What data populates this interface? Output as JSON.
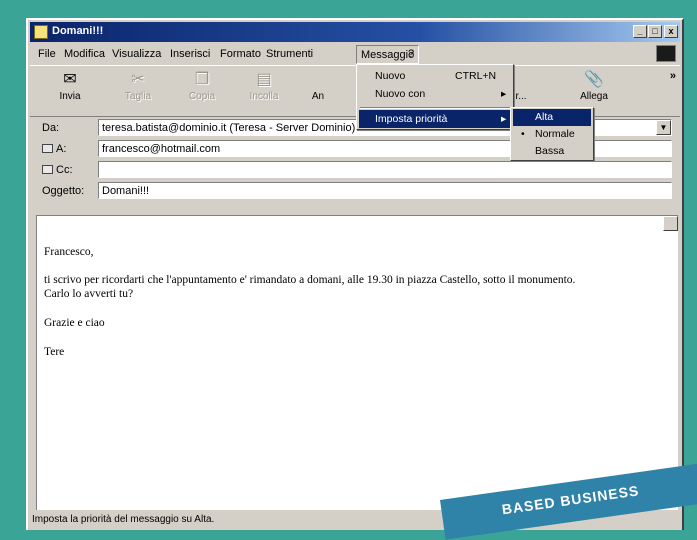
{
  "window": {
    "title": "Domani!!!",
    "controls": {
      "minimize": "_",
      "maximize": "□",
      "close": "x"
    }
  },
  "menubar": {
    "items": [
      "File",
      "Modifica",
      "Visualizza",
      "Inserisci",
      "Formato",
      "Strumenti",
      "Messaggio",
      "?"
    ]
  },
  "toolbar": {
    "buttons": [
      {
        "label": "Invia",
        "icon": "send-icon",
        "enabled": true
      },
      {
        "label": "Taglia",
        "icon": "scissors-icon",
        "enabled": false
      },
      {
        "label": "Copia",
        "icon": "copy-icon",
        "enabled": false
      },
      {
        "label": "Incolla",
        "icon": "paste-icon",
        "enabled": false
      },
      {
        "label": "An",
        "icon": "undo-icon",
        "enabled": true
      },
      {
        "label": "r...",
        "icon": "",
        "enabled": true
      },
      {
        "label": "Allega",
        "icon": "paperclip-icon",
        "enabled": true
      }
    ],
    "overflow": "»"
  },
  "fields": {
    "from": {
      "label": "Da:",
      "value": "teresa.batista@dominio.it   (Teresa - Server Dominio)"
    },
    "to": {
      "label": "A:",
      "value": "francesco@hotmail.com"
    },
    "cc": {
      "label": "Cc:",
      "value": ""
    },
    "subject": {
      "label": "Oggetto:",
      "value": "Domani!!!"
    }
  },
  "body": {
    "lines": [
      "Francesco,",
      "ti scrivo per ricordarti che l'appuntamento e' rimandato a domani, alle 19.30 in piazza Castello, sotto il monumento.",
      "Carlo lo avverti tu?",
      "Grazie e ciao",
      "Tere"
    ]
  },
  "messaggio_menu": {
    "items": [
      {
        "label": "Nuovo",
        "shortcut": "CTRL+N"
      },
      {
        "label": "Nuovo con",
        "submenu": "▸"
      },
      {
        "label": "Imposta priorità",
        "submenu": "▸"
      }
    ]
  },
  "priority_submenu": {
    "items": [
      {
        "label": "Alta",
        "selected": true
      },
      {
        "label": "Normale",
        "checked": true,
        "mark": "•"
      },
      {
        "label": "Bassa"
      }
    ]
  },
  "statusbar": {
    "text": "Imposta la priorità del messaggio su Alta."
  },
  "banner": {
    "text": "BASED BUSINESS"
  },
  "colors": {
    "background": "#3aa597",
    "title_start": "#0a246a",
    "highlight": "#0a246a",
    "banner": "#2f82a8"
  }
}
